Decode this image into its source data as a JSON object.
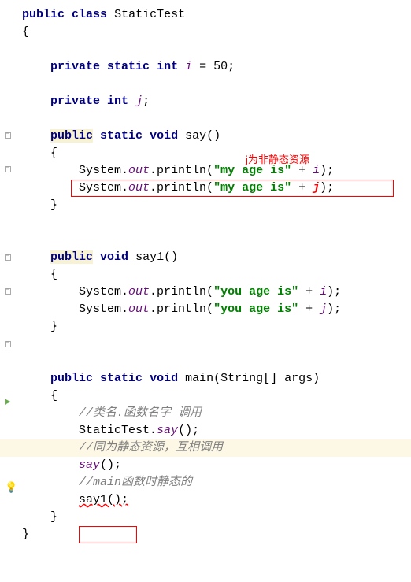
{
  "code": {
    "kw_public": "public",
    "kw_class": "class",
    "class_name": "StaticTest",
    "brace_open": "{",
    "brace_close": "}",
    "kw_private": "private",
    "kw_static": "static",
    "kw_int": "int",
    "kw_void": "void",
    "field_i": "i",
    "field_j": "j",
    "assign_50": " = 50;",
    "semicolon": ";",
    "method_say": "say()",
    "method_say1": "say1()",
    "method_main": "main(String[] args)",
    "system": "System.",
    "out": "out",
    "println": ".println(",
    "str_my_age": "\"my age is\"",
    "str_you_age": "\"you age is\"",
    "plus": " + ",
    "close_paren_semi": ");",
    "comment1": "//类名.函数名字 调用",
    "call1": "StaticTest.",
    "call1b": "say",
    "call1c": "();",
    "comment2": "//同为静态资源，互相调用",
    "call2": "say",
    "call2b": "();",
    "comment3": "//main函数时静态的",
    "call3": "say1();"
  },
  "annotation": {
    "text1": "j为非静态资源"
  }
}
